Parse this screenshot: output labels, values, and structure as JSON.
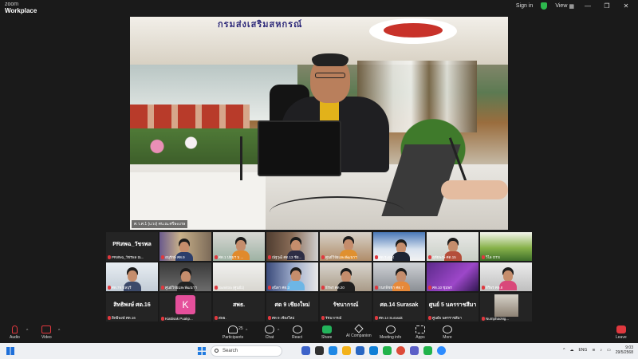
{
  "app": {
    "logo_top": "zoom",
    "logo_bottom": "Workplace"
  },
  "titlebar": {
    "sign_in": "Sign in",
    "view": "View"
  },
  "main_video": {
    "headline": "กรมส่งเสริมสหกรณ์",
    "name": "ศ.ว.ศ.1 (แวง) ศบ.ณ.ศรีษะเกษ"
  },
  "gallery": [
    {
      "big": "PRสพฉ_วัชรพล",
      "label": "PRสพฉ_วัชรพล ณ..."
    },
    {
      "label": "อนุรักษ์ ศด.9"
    },
    {
      "label": "ศด.1 ปทุมฯ บ ..."
    },
    {
      "label": "ณัฐวุฒิ ศด.13 ชัย..."
    },
    {
      "label": "ศูนย์วิจัยและพัฒนาฯ"
    },
    {
      "label": "ศด.ระยอง"
    },
    {
      "label": "อุทัยพงษ์ ศด.15"
    },
    {
      "label": "วิไล OTS"
    },
    {
      "label": "ศด.7จ ชลบุรี"
    },
    {
      "label": "ศูนย์วิจัยและพัฒนาฯ"
    },
    {
      "label": "Sumittra (ศูนย์1)"
    },
    {
      "label": "สุนิดา ศด.3"
    },
    {
      "label": "ธีรพร ศด.20"
    },
    {
      "label": "กนกพิชชา ศด.7"
    },
    {
      "label": "ศด.10 ชุมพร"
    },
    {
      "label": "สิริพร ศด.8"
    },
    {
      "big": "สิทธิพงษ์ ศด.16",
      "label": "สิทธิพงษ์ ศด.16"
    },
    {
      "avatar": "K",
      "label": "Kiattisak Puakp..."
    },
    {
      "big": "สพธ.",
      "label": "สพธ."
    },
    {
      "big": "ศด 9 เชียงใหม่",
      "label": "ศด 9 เชียงใหม่"
    },
    {
      "big": "รัชนากรณ์",
      "label": "รัชนากรณ์"
    },
    {
      "big": "ศด.14 Surasak",
      "label": "ศด.14 Surasak"
    },
    {
      "big": "ศูนย์ 5 นครราชสีมา",
      "label": "ศูนย์5 นครราชสีมา"
    },
    {
      "label": "NumphaoNg..."
    }
  ],
  "toolbar": {
    "audio": "Audio",
    "video": "Video",
    "participants": "Participants",
    "participants_count": "25",
    "chat": "Chat",
    "react": "React",
    "share": "Share",
    "ai": "AI Companion",
    "meeting_info": "Meeting info",
    "apps": "Apps",
    "more": "More",
    "leave": "Leave"
  },
  "taskbar": {
    "search": "Search",
    "lang": "ENG",
    "time": "9:03",
    "date": "29/5/2568"
  },
  "colors": {
    "mute_red": "#e0383e",
    "share_green": "#23b35b",
    "avatar_pink": "#e54f9b",
    "taskbar_bg": "#eef0f3"
  }
}
